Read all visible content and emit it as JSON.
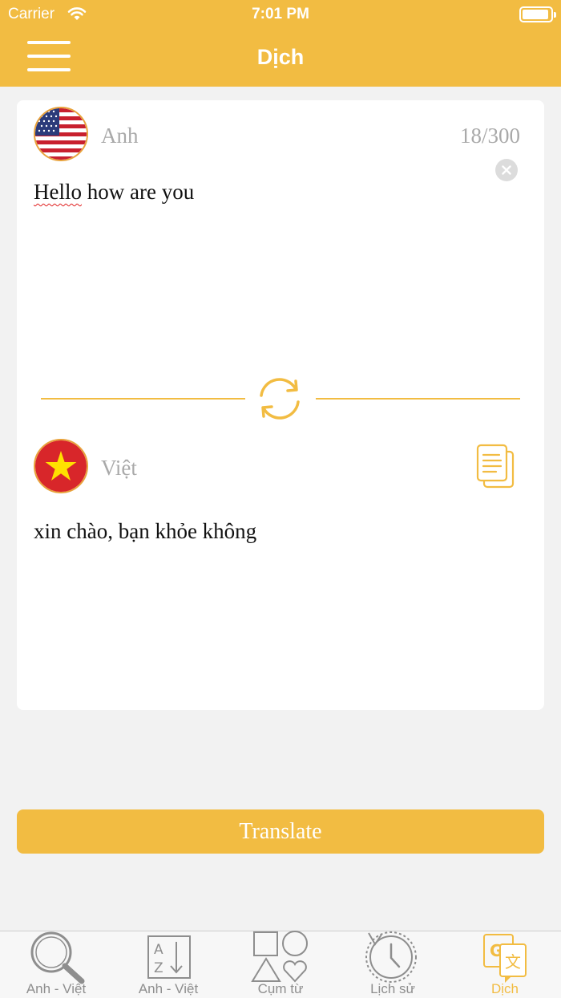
{
  "status_bar": {
    "carrier": "Carrier",
    "time": "7:01 PM"
  },
  "header": {
    "title": "Dịch"
  },
  "source": {
    "language": "Anh",
    "counter": "18/300",
    "text_misspelled": "Hello",
    "text_rest": " how are you"
  },
  "target": {
    "language": "Việt",
    "text": "xin chào, bạn khỏe không"
  },
  "translate_label": "Translate",
  "tabs": [
    {
      "label": "Anh - Việt",
      "icon": "search-icon"
    },
    {
      "label": "Anh - Việt",
      "icon": "alphabet-sort-icon"
    },
    {
      "label": "Cụm từ",
      "icon": "shapes-icon"
    },
    {
      "label": "Lịch sử",
      "icon": "history-icon"
    },
    {
      "label": "Dịch",
      "icon": "translate-icon",
      "active": true
    }
  ],
  "colors": {
    "accent": "#f2bc42",
    "inactive": "#8e8e8e"
  }
}
